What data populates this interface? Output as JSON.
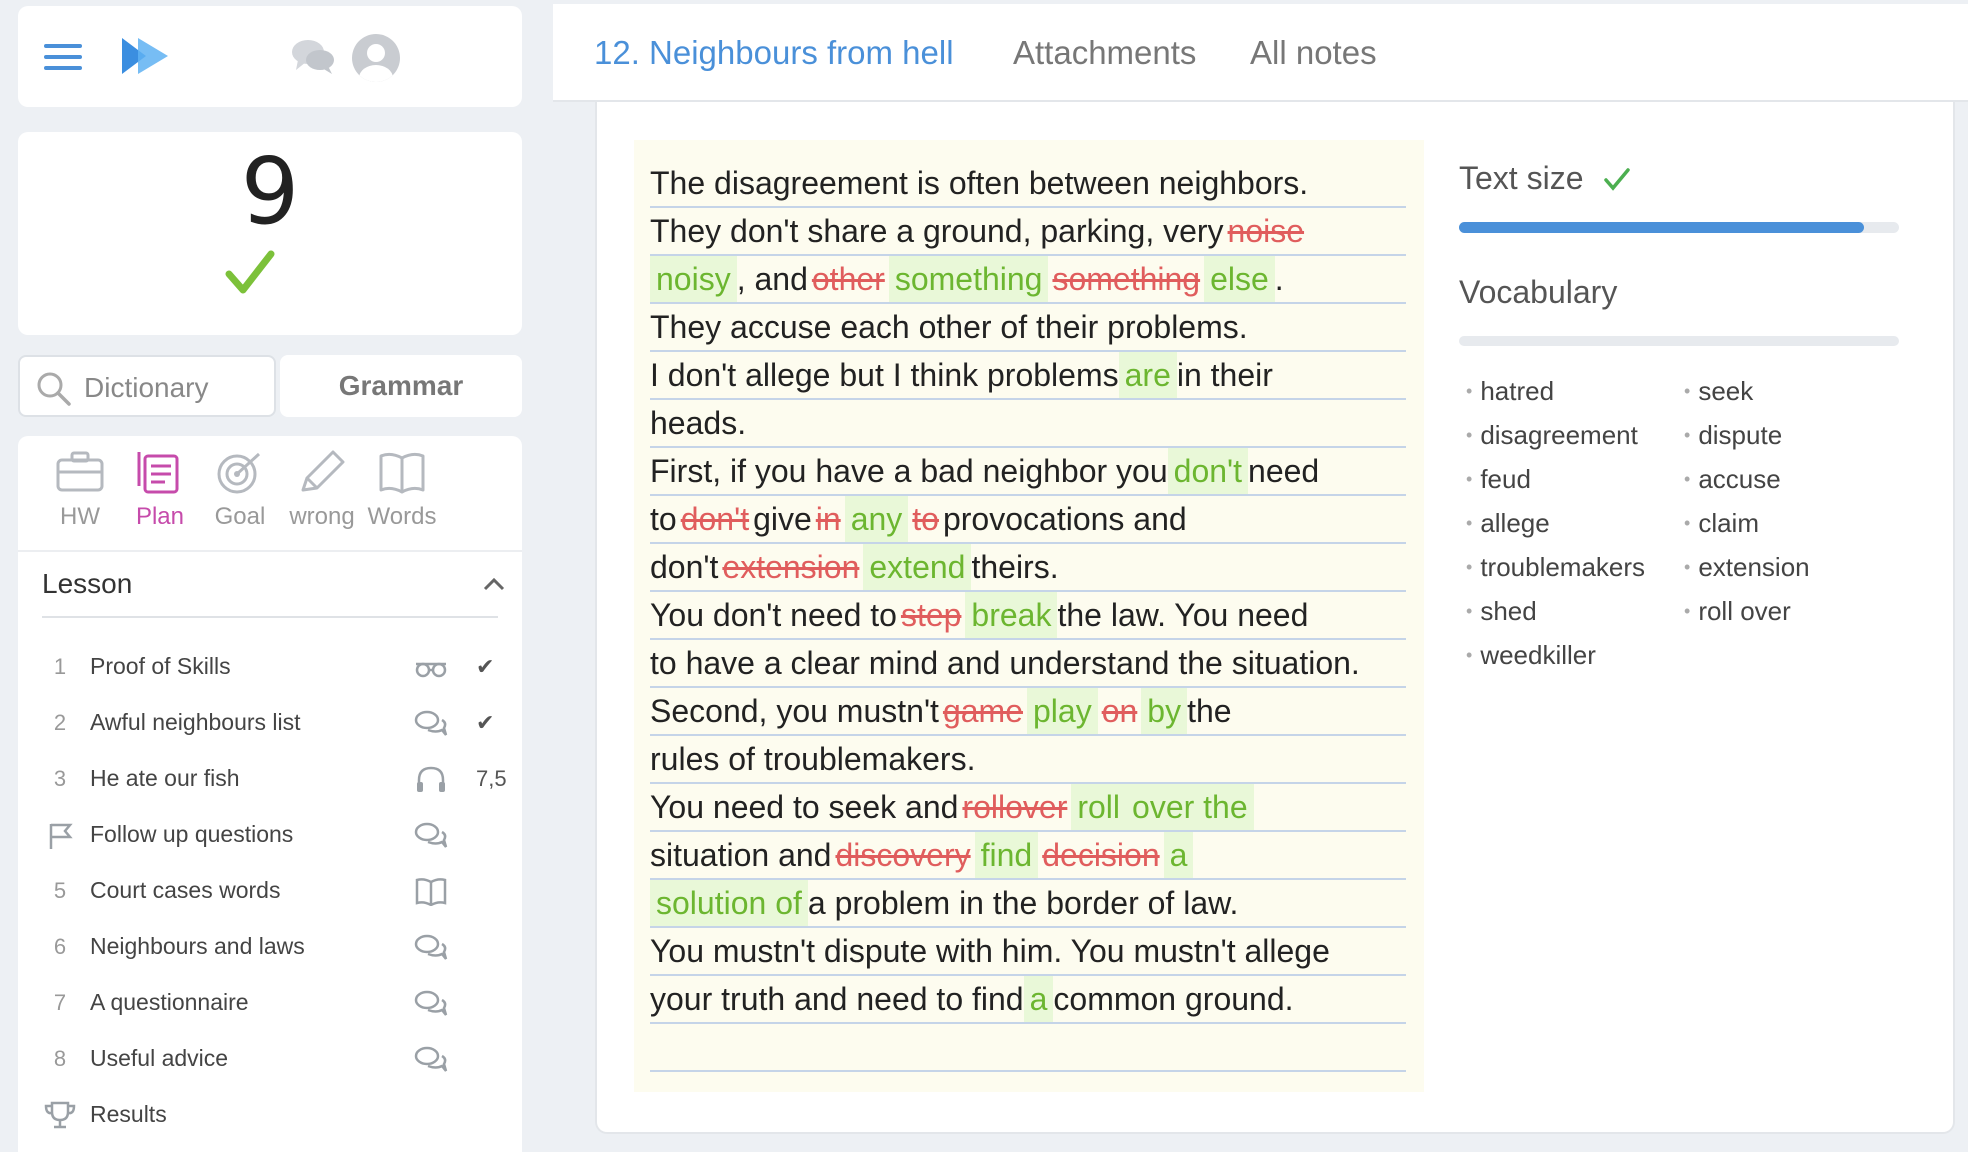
{
  "header": {
    "tabs": [
      {
        "label": "12. Neighbours from hell",
        "active": true
      },
      {
        "label": "Attachments",
        "active": false
      },
      {
        "label": "All notes",
        "active": false
      }
    ]
  },
  "score": {
    "value": "9"
  },
  "tools": {
    "dictionary_placeholder": "Dictionary",
    "grammar_label": "Grammar"
  },
  "nav_tabs": [
    {
      "label": "HW",
      "icon": "briefcase-icon"
    },
    {
      "label": "Plan",
      "icon": "plan-icon",
      "active": true
    },
    {
      "label": "Goal",
      "icon": "target-icon"
    },
    {
      "label": "wrong",
      "icon": "pencil-icon"
    },
    {
      "label": "Words",
      "icon": "book-icon"
    }
  ],
  "lesson": {
    "title": "Lesson",
    "items": [
      {
        "num": "1",
        "title": "Proof of Skills",
        "icon": "glasses-icon",
        "status": "✔"
      },
      {
        "num": "2",
        "title": "Awful neighbours list",
        "icon": "chat-icon",
        "status": "✔"
      },
      {
        "num": "3",
        "title": "He ate our fish",
        "icon": "headphones-icon",
        "status": "7,5"
      },
      {
        "num": "",
        "title": "Follow up questions",
        "icon": "chat-icon",
        "status": "",
        "lead_icon": "flag-icon"
      },
      {
        "num": "5",
        "title": "Court cases words",
        "icon": "book-icon",
        "status": ""
      },
      {
        "num": "6",
        "title": "Neighbours and laws",
        "icon": "chat-icon",
        "status": ""
      },
      {
        "num": "7",
        "title": "A questionnaire",
        "icon": "chat-icon",
        "status": ""
      },
      {
        "num": "8",
        "title": "Useful advice",
        "icon": "chat-icon",
        "status": ""
      },
      {
        "num": "",
        "title": "Results",
        "icon": "",
        "status": "",
        "lead_icon": "trophy-icon"
      }
    ]
  },
  "colors": {
    "accent": "#4a90d9",
    "plan": "#c64bab",
    "correct": "#6cb630",
    "wrong": "#e05d5d",
    "paper": "#fdfcef"
  },
  "text_lines": [
    [
      {
        "t": " The disagreement is often between neighbors."
      }
    ],
    [
      {
        "t": "They don't share a ground, parking, very "
      },
      {
        "t": "noise",
        "c": "r"
      },
      {
        "t": " ",
        "c": "g"
      }
    ],
    [
      {
        "t": "noisy",
        "c": "g"
      },
      {
        "t": " , and "
      },
      {
        "t": "other",
        "c": "r"
      },
      {
        "t": "something",
        "c": "g"
      },
      {
        "t": "  "
      },
      {
        "t": "something",
        "c": "r"
      },
      {
        "t": "else",
        "c": "g"
      },
      {
        "t": " ."
      }
    ],
    [
      {
        "t": "They accuse each other of their problems."
      }
    ],
    [
      {
        "t": "I don't allege but I think problems "
      },
      {
        "t": "are ",
        "c": "g"
      },
      {
        "t": " in their"
      }
    ],
    [
      {
        "t": "heads."
      }
    ],
    [
      {
        "t": "First, if you have a bad neighbor you "
      },
      {
        "t": "don't ",
        "c": "g"
      },
      {
        "t": " need"
      }
    ],
    [
      {
        "t": "to "
      },
      {
        "t": "don't",
        "c": "r"
      },
      {
        "t": " give "
      },
      {
        "t": "in",
        "c": "r"
      },
      {
        "t": "any",
        "c": "g"
      },
      {
        "t": "  "
      },
      {
        "t": "to",
        "c": "r"
      },
      {
        "t": " provocations and"
      }
    ],
    [
      {
        "t": "don't "
      },
      {
        "t": "extension",
        "c": "r"
      },
      {
        "t": "extend ",
        "c": "g"
      },
      {
        "t": " theirs."
      }
    ],
    [
      {
        "t": "You don't need to "
      },
      {
        "t": "step",
        "c": "r"
      },
      {
        "t": "break ",
        "c": "g"
      },
      {
        "t": " the law. You need"
      }
    ],
    [
      {
        "t": "to have a clear mind and understand the situation."
      }
    ],
    [
      {
        "t": "Second, you mustn't "
      },
      {
        "t": "game",
        "c": "r"
      },
      {
        "t": "play ",
        "c": "g"
      },
      {
        "t": "  "
      },
      {
        "t": "on",
        "c": "r"
      },
      {
        "t": "by ",
        "c": "g"
      },
      {
        "t": "  the"
      }
    ],
    [
      {
        "t": "rules of troublemakers."
      }
    ],
    [
      {
        "t": "You need to seek and "
      },
      {
        "t": "rollover",
        "c": "r"
      },
      {
        "t": "roll ",
        "c": "g"
      },
      {
        "t": "  "
      },
      {
        "t": "over the ",
        "c": "g"
      }
    ],
    [
      {
        "t": "situation and "
      },
      {
        "t": "discovery",
        "c": "r"
      },
      {
        "t": "find ",
        "c": "g"
      },
      {
        "t": "  "
      },
      {
        "t": "decision",
        "c": "r"
      },
      {
        "t": "a ",
        "c": "g"
      },
      {
        "t": "  "
      },
      {
        "t": " ",
        "c": "g"
      }
    ],
    [
      {
        "t": "solution of ",
        "c": "g"
      },
      {
        "t": " a problem in the border of law."
      }
    ],
    [
      {
        "t": "You mustn't dispute with him. You mustn't allege"
      }
    ],
    [
      {
        "t": "your truth and need to find "
      },
      {
        "t": "a ",
        "c": "g"
      },
      {
        "t": " common ground."
      }
    ],
    [
      {
        "t": ""
      }
    ]
  ],
  "text_size": {
    "label": "Text size",
    "level": 0.92
  },
  "vocabulary": {
    "label": "Vocabulary",
    "col1": [
      "hatred",
      "disagreement",
      "feud",
      "allege",
      "troublemakers",
      "shed",
      "weedkiller"
    ],
    "col2": [
      "seek",
      "dispute",
      "accuse",
      "claim",
      "extension",
      "roll over"
    ]
  }
}
